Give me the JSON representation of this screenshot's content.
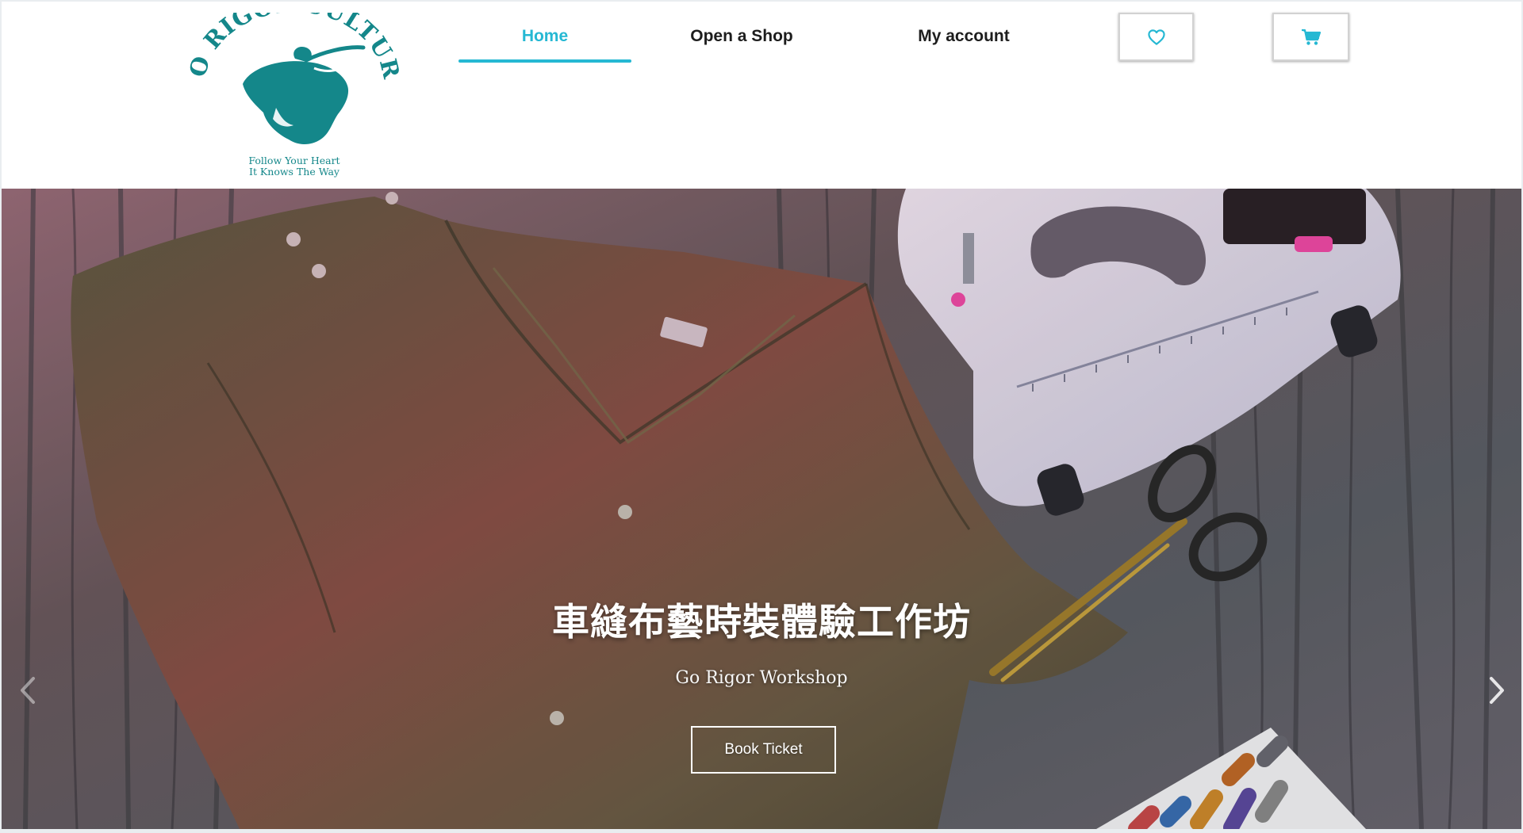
{
  "brand": {
    "name": "GO RIGOR CULTURE",
    "tagline_line1": "Follow Your Heart",
    "tagline_line2": "It Knows The Way",
    "color": "#14878a"
  },
  "nav": {
    "items": [
      {
        "label": "Home",
        "active": true
      },
      {
        "label": "Open a Shop",
        "active": false
      },
      {
        "label": "My account",
        "active": false
      }
    ],
    "accent": "#25b8d3"
  },
  "header_buttons": {
    "wishlist_icon": "heart-icon",
    "cart_icon": "cart-icon"
  },
  "hero": {
    "title": "車縫布藝時裝體驗工作坊",
    "subtitle": "Go Rigor Workshop",
    "button_label": "Book Ticket",
    "prev_icon": "chevron-left-icon",
    "next_icon": "chevron-right-icon"
  }
}
